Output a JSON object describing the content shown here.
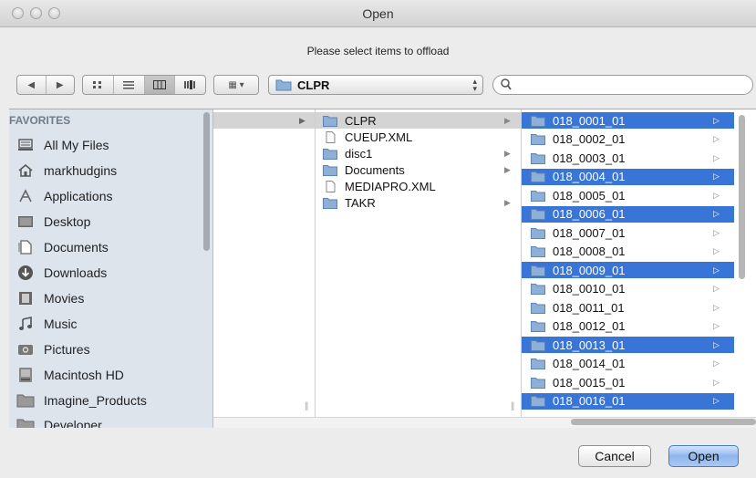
{
  "window": {
    "title": "Open",
    "prompt": "Please select items to offload"
  },
  "toolbar": {
    "back": "◀",
    "forward": "▶",
    "view_icons": "▫▫",
    "view_list": "≡",
    "view_columns": "▥",
    "view_coverflow": "▮▮",
    "arrange": "▦ ▾",
    "path_label": "CLPR",
    "search_placeholder": ""
  },
  "sidebar": {
    "heading": "FAVORITES",
    "items": [
      {
        "label": "All My Files",
        "icon": "all-files-icon"
      },
      {
        "label": "markhudgins",
        "icon": "home-icon"
      },
      {
        "label": "Applications",
        "icon": "applications-icon"
      },
      {
        "label": "Desktop",
        "icon": "desktop-icon"
      },
      {
        "label": "Documents",
        "icon": "documents-icon"
      },
      {
        "label": "Downloads",
        "icon": "downloads-icon"
      },
      {
        "label": "Movies",
        "icon": "movies-icon"
      },
      {
        "label": "Music",
        "icon": "music-icon"
      },
      {
        "label": "Pictures",
        "icon": "pictures-icon"
      },
      {
        "label": "Macintosh HD",
        "icon": "harddisk-icon"
      },
      {
        "label": "Imagine_Products",
        "icon": "folder-icon"
      },
      {
        "label": "Developer",
        "icon": "folder-icon"
      }
    ]
  },
  "columns": {
    "col2": [
      {
        "label": "CLPR",
        "type": "folder",
        "arrow": true,
        "selected": true
      },
      {
        "label": "CUEUP.XML",
        "type": "file",
        "arrow": false,
        "selected": false
      },
      {
        "label": "disc1",
        "type": "folder",
        "arrow": true,
        "selected": false
      },
      {
        "label": "Documents",
        "type": "folder",
        "arrow": true,
        "selected": false
      },
      {
        "label": "MEDIAPRO.XML",
        "type": "file",
        "arrow": false,
        "selected": false
      },
      {
        "label": "TAKR",
        "type": "folder",
        "arrow": true,
        "selected": false
      }
    ],
    "col3": [
      {
        "label": "018_0001_01",
        "selected": true
      },
      {
        "label": "018_0002_01",
        "selected": false
      },
      {
        "label": "018_0003_01",
        "selected": false
      },
      {
        "label": "018_0004_01",
        "selected": true
      },
      {
        "label": "018_0005_01",
        "selected": false
      },
      {
        "label": "018_0006_01",
        "selected": true
      },
      {
        "label": "018_0007_01",
        "selected": false
      },
      {
        "label": "018_0008_01",
        "selected": false
      },
      {
        "label": "018_0009_01",
        "selected": true
      },
      {
        "label": "018_0010_01",
        "selected": false
      },
      {
        "label": "018_0011_01",
        "selected": false
      },
      {
        "label": "018_0012_01",
        "selected": false
      },
      {
        "label": "018_0013_01",
        "selected": true
      },
      {
        "label": "018_0014_01",
        "selected": false
      },
      {
        "label": "018_0015_01",
        "selected": false
      },
      {
        "label": "018_0016_01",
        "selected": true
      }
    ]
  },
  "buttons": {
    "cancel": "Cancel",
    "open": "Open"
  },
  "colors": {
    "selection": "#3875d7",
    "sidebar_bg": "#dde4ec",
    "folder": "#8fb0d6"
  }
}
